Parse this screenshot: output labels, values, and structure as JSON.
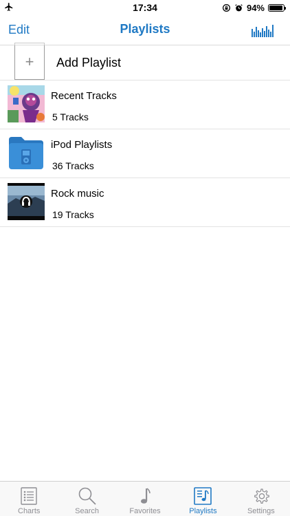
{
  "status_bar": {
    "time": "17:34",
    "battery": "94%",
    "battery_level": 0.94,
    "icons": [
      "airplane-icon",
      "rotation-lock-icon",
      "alarm-icon",
      "battery-icon"
    ]
  },
  "nav": {
    "edit_label": "Edit",
    "title": "Playlists",
    "right_icon": "equalizer-icon"
  },
  "add_row": {
    "label": "Add Playlist",
    "plus": "+"
  },
  "playlists": [
    {
      "title": "Recent Tracks",
      "subtitle": "5 Tracks",
      "artwork": "album-art"
    },
    {
      "title": "iPod Playlists",
      "subtitle": "36 Tracks",
      "artwork": "folder-icon"
    },
    {
      "title": "Rock music",
      "subtitle": "19 Tracks",
      "artwork": "album-art"
    }
  ],
  "tabs": [
    {
      "label": "Charts",
      "icon": "list-icon"
    },
    {
      "label": "Search",
      "icon": "search-icon"
    },
    {
      "label": "Favorites",
      "icon": "music-note-icon"
    },
    {
      "label": "Playlists",
      "icon": "playlist-icon",
      "active": true
    },
    {
      "label": "Settings",
      "icon": "gear-icon"
    }
  ],
  "colors": {
    "accent": "#1f79c4",
    "inactive_tab": "#8e8e93",
    "separator": "#e2e2e2"
  }
}
